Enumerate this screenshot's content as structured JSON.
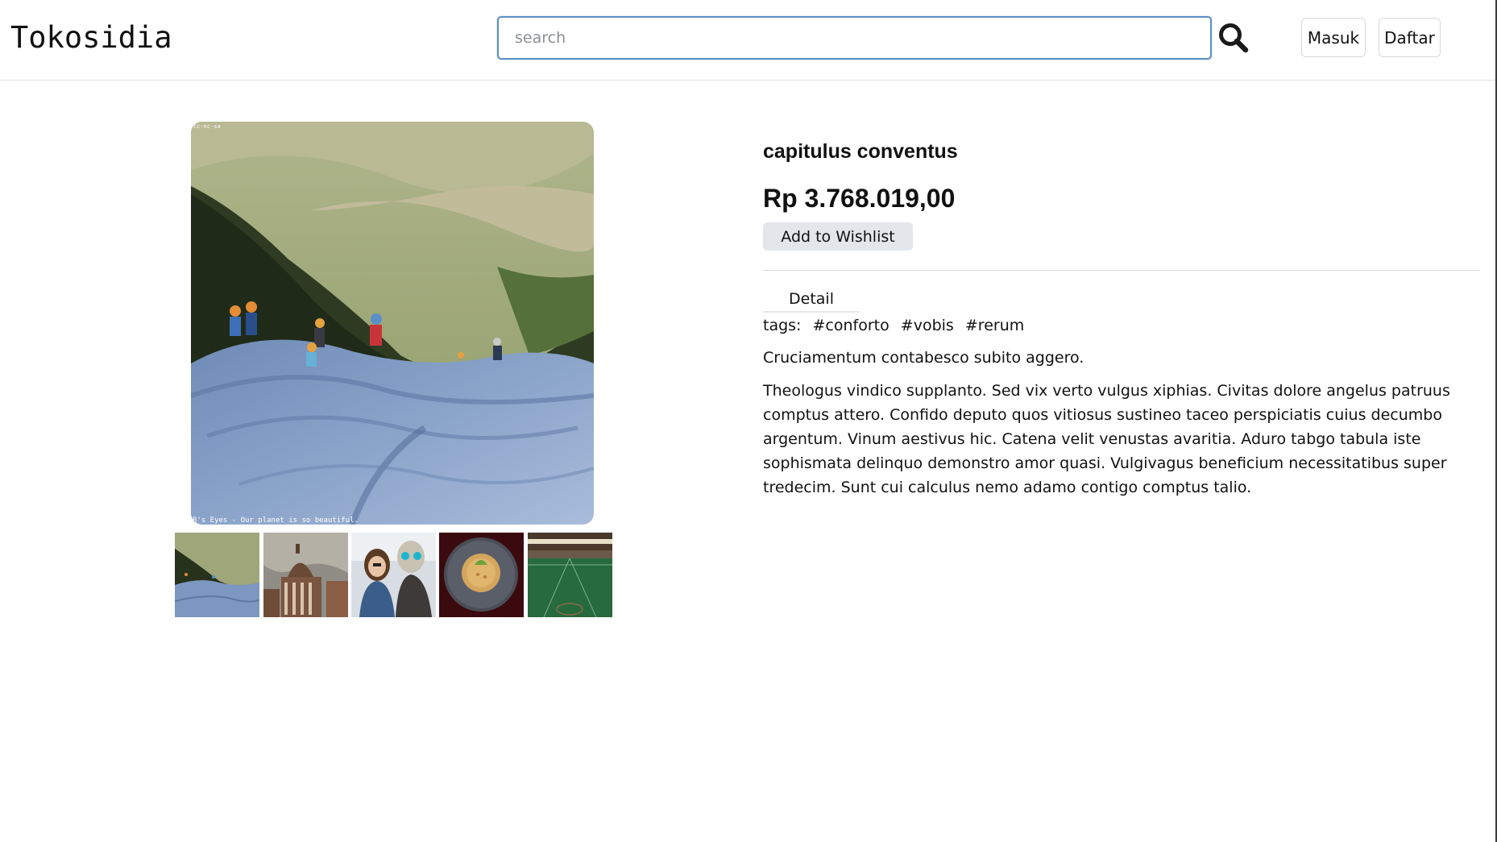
{
  "header": {
    "logo": "Tokosidia",
    "search": {
      "placeholder": "search",
      "value": ""
    },
    "search_icon": "search-icon",
    "login_label": "Masuk",
    "register_label": "Daftar"
  },
  "product": {
    "name": "capitulus conventus",
    "price": "Rp 3.768.019,00",
    "wishlist_label": "Add to Wishlist",
    "main_image": {
      "subject": "hikers climbing a granite rock slope",
      "caption_top": "cc-nc-sa",
      "caption_bottom": "R's Eyes - Our planet is so beautiful."
    },
    "thumbnails": [
      {
        "subject": "hikers on rock slope"
      },
      {
        "subject": "ornate dome building under stormy sky"
      },
      {
        "subject": "woman posing with skeleton costume character"
      },
      {
        "subject": "plated risotto dish"
      },
      {
        "subject": "indoor sports hall court"
      }
    ]
  },
  "detail": {
    "tab_label": "Detail",
    "tags_label": "tags:",
    "tags": [
      "#conforto",
      "#vobis",
      "#rerum"
    ],
    "short_description": "Cruciamentum contabesco subito aggero.",
    "description": "Theologus vindico supplanto. Sed vix verto vulgus xiphias. Civitas dolore angelus patruus comptus attero. Confido deputo quos vitiosus sustineo taceo perspiciatis cuius decumbo argentum. Vinum aestivus hic. Catena velit venustas avaritia. Aduro tabgo tabula iste sophismata delinquo demonstro amor quasi. Vulgivagus beneficium necessitatibus super tredecim. Sunt cui calculus nemo adamo contigo comptus talio."
  },
  "colors": {
    "search_border": "#5b8fc7",
    "wishlist_bg": "#e3e6ea",
    "divider": "#d5d8db"
  }
}
